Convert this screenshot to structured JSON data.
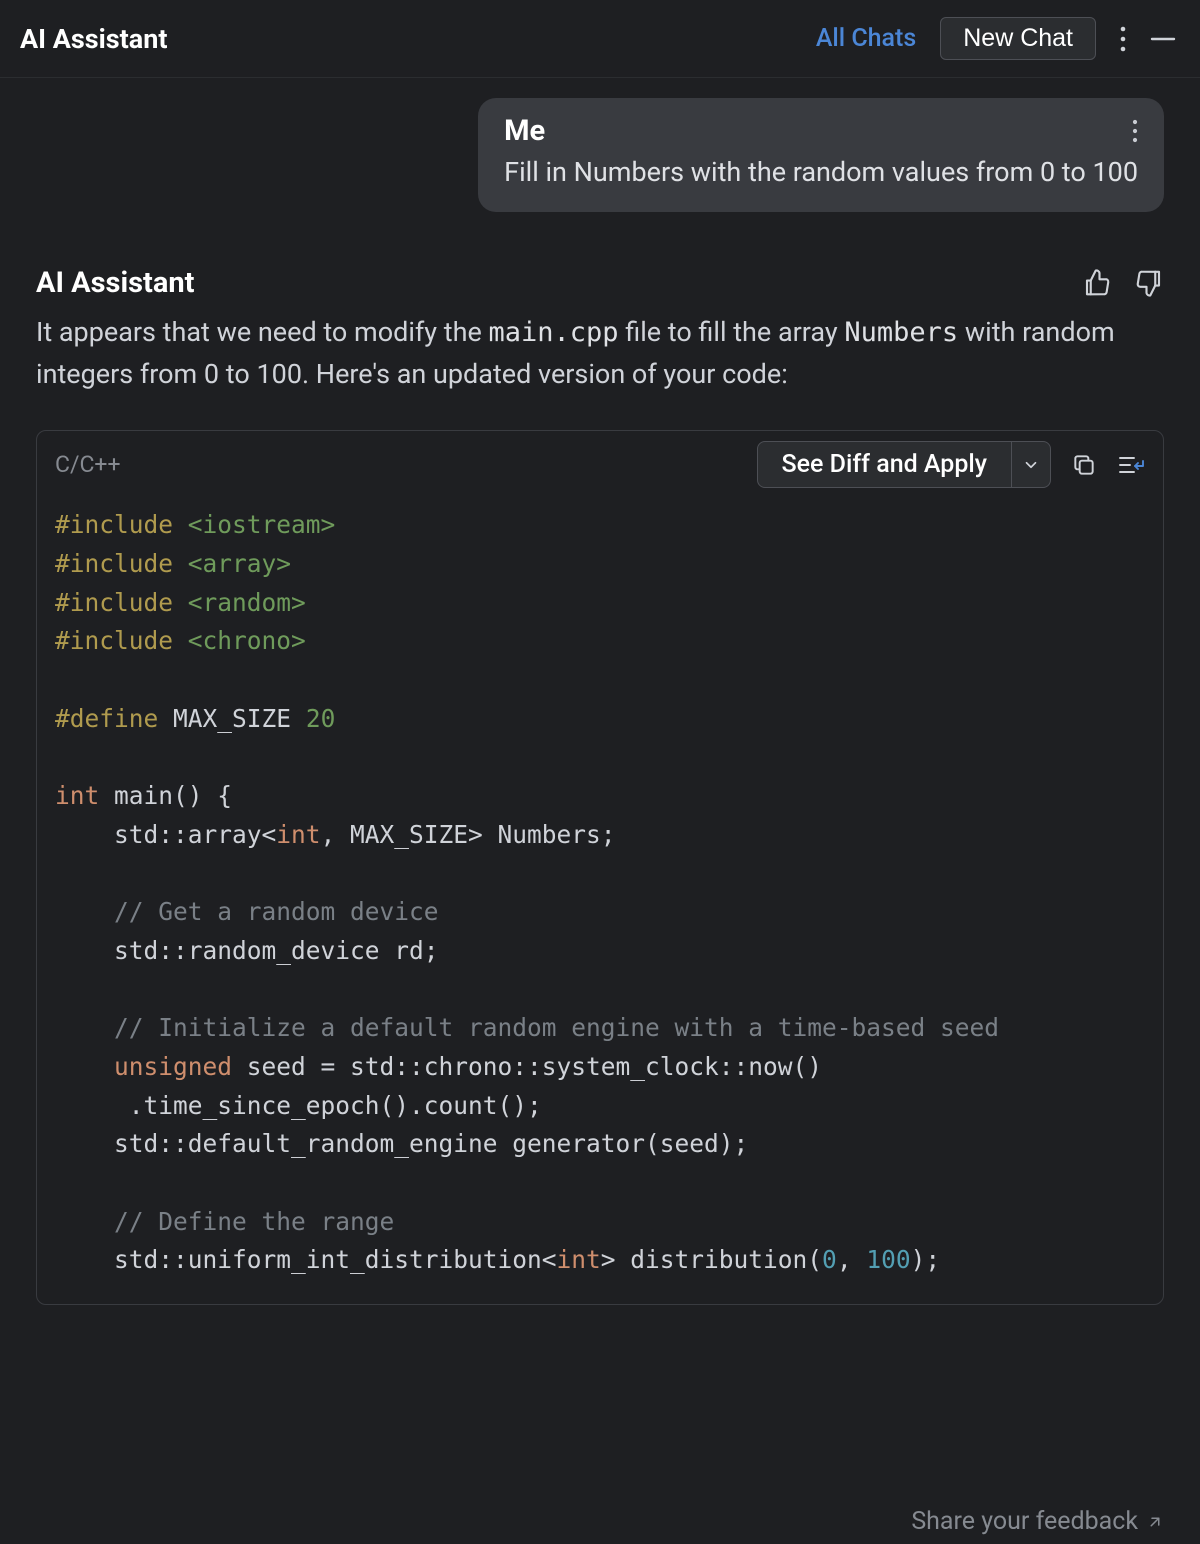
{
  "header": {
    "title": "AI Assistant",
    "all_chats": "All Chats",
    "new_chat": "New Chat"
  },
  "user": {
    "name": "Me",
    "message": "Fill in Numbers with the random values from 0 to 100"
  },
  "ai": {
    "name": "AI Assistant",
    "reply_pre": "It appears that we need to modify the ",
    "reply_file": "main.cpp",
    "reply_mid": " file to fill the array ",
    "reply_var": "Numbers",
    "reply_post": " with random integers from 0 to 100. Here's an updated version of your code:"
  },
  "code": {
    "language": "C/C++",
    "diff_button": "See Diff and Apply",
    "tokens": {
      "include": "#include",
      "iostream": "<iostream>",
      "array": "<array>",
      "random": "<random>",
      "chrono": "<chrono>",
      "define": "#define",
      "max_size": "MAX_SIZE",
      "max_val": "20",
      "int": "int",
      "main_sig": " main() {",
      "arr_pre": "    std::array<",
      "arr_mid": ", MAX_SIZE> Numbers;",
      "c_get": "    // Get a random device",
      "rd": "    std::random_device rd;",
      "c_init": "    // Initialize a default random engine with a time-based seed",
      "unsigned": "unsigned",
      "seed_line": " seed = std::chrono::system_clock::now()",
      "seed_line2": "     .time_since_epoch().count();",
      "gen": "    std::default_random_engine generator(seed);",
      "c_range": "    // Define the range",
      "dist_pre": "    std::uniform_int_distribution<",
      "dist_mid": "> distribution(",
      "zero": "0",
      "comma": ", ",
      "hundred": "100",
      "dist_end": ");"
    }
  },
  "footer": {
    "feedback": "Share your feedback"
  }
}
